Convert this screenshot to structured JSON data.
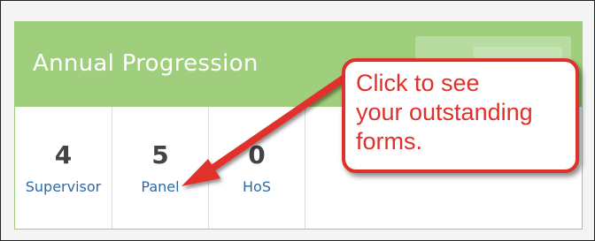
{
  "panel": {
    "title": "Annual Progression"
  },
  "stats": [
    {
      "value": "4",
      "label": "Supervisor"
    },
    {
      "value": "5",
      "label": "Panel"
    },
    {
      "value": "0",
      "label": "HoS"
    }
  ],
  "callout": {
    "lines": [
      "Click to see",
      "your outstanding",
      "forms."
    ],
    "color": "#e0302a"
  },
  "colors": {
    "header": "#9fcf7c",
    "link": "#2c6aa3"
  }
}
